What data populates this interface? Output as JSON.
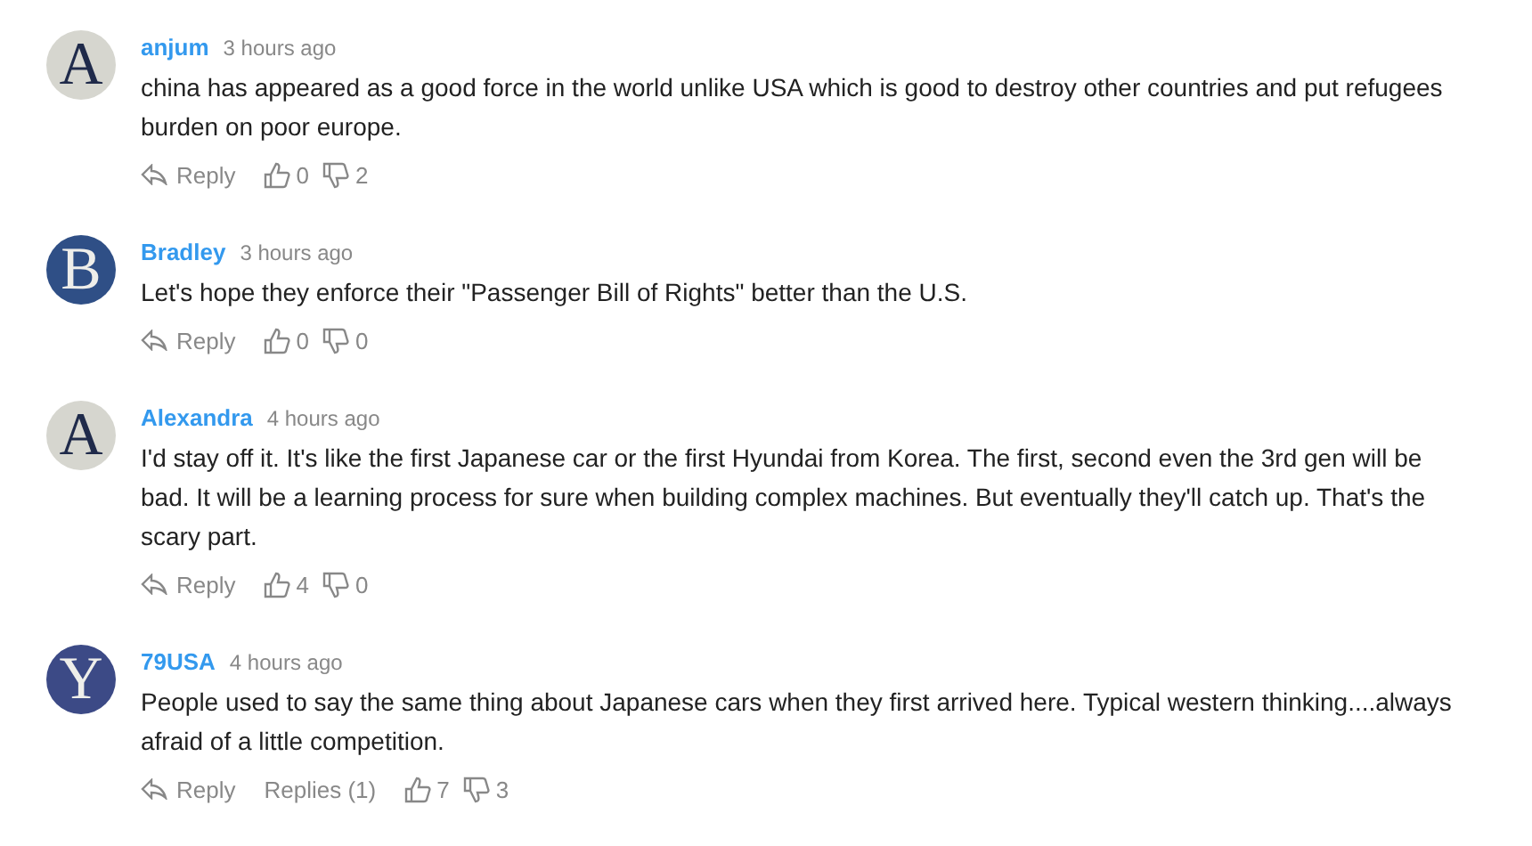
{
  "comments": [
    {
      "author": "anjum",
      "time": "3 hours ago",
      "avatar": {
        "letter": "A",
        "color": "#d6d6cf",
        "kind": "light"
      },
      "text": "china has appeared as a good force in the world unlike USA which is good to destroy other countries and put refugees burden on poor europe.",
      "reply": "Reply",
      "likes": "0",
      "dislikes": "2"
    },
    {
      "author": "Bradley",
      "time": "3 hours ago",
      "avatar": {
        "letter": "B",
        "color": "#2f4f86",
        "kind": "dark"
      },
      "text": "Let's hope they enforce their \"Passenger Bill of Rights\" better than the U.S.",
      "reply": "Reply",
      "likes": "0",
      "dislikes": "0"
    },
    {
      "author": "Alexandra",
      "time": "4 hours ago",
      "avatar": {
        "letter": "A",
        "color": "#d6d6cf",
        "kind": "light"
      },
      "text": "I'd stay off it. It's like the first Japanese car or the first Hyundai from Korea. The first, second even the 3rd gen will be bad. It will be a learning process for sure when building complex machines. But eventually they'll catch up. That's the scary part.",
      "reply": "Reply",
      "likes": "4",
      "dislikes": "0"
    },
    {
      "author": "79USA",
      "time": "4 hours ago",
      "avatar": {
        "letter": "Y",
        "color": "#3c4a86",
        "kind": "dark"
      },
      "text": "People used to say the same thing about Japanese cars when they first arrived here. Typical western thinking....always afraid of a little competition.",
      "reply": "Reply",
      "replies": "Replies (1)",
      "likes": "7",
      "dislikes": "3"
    }
  ]
}
